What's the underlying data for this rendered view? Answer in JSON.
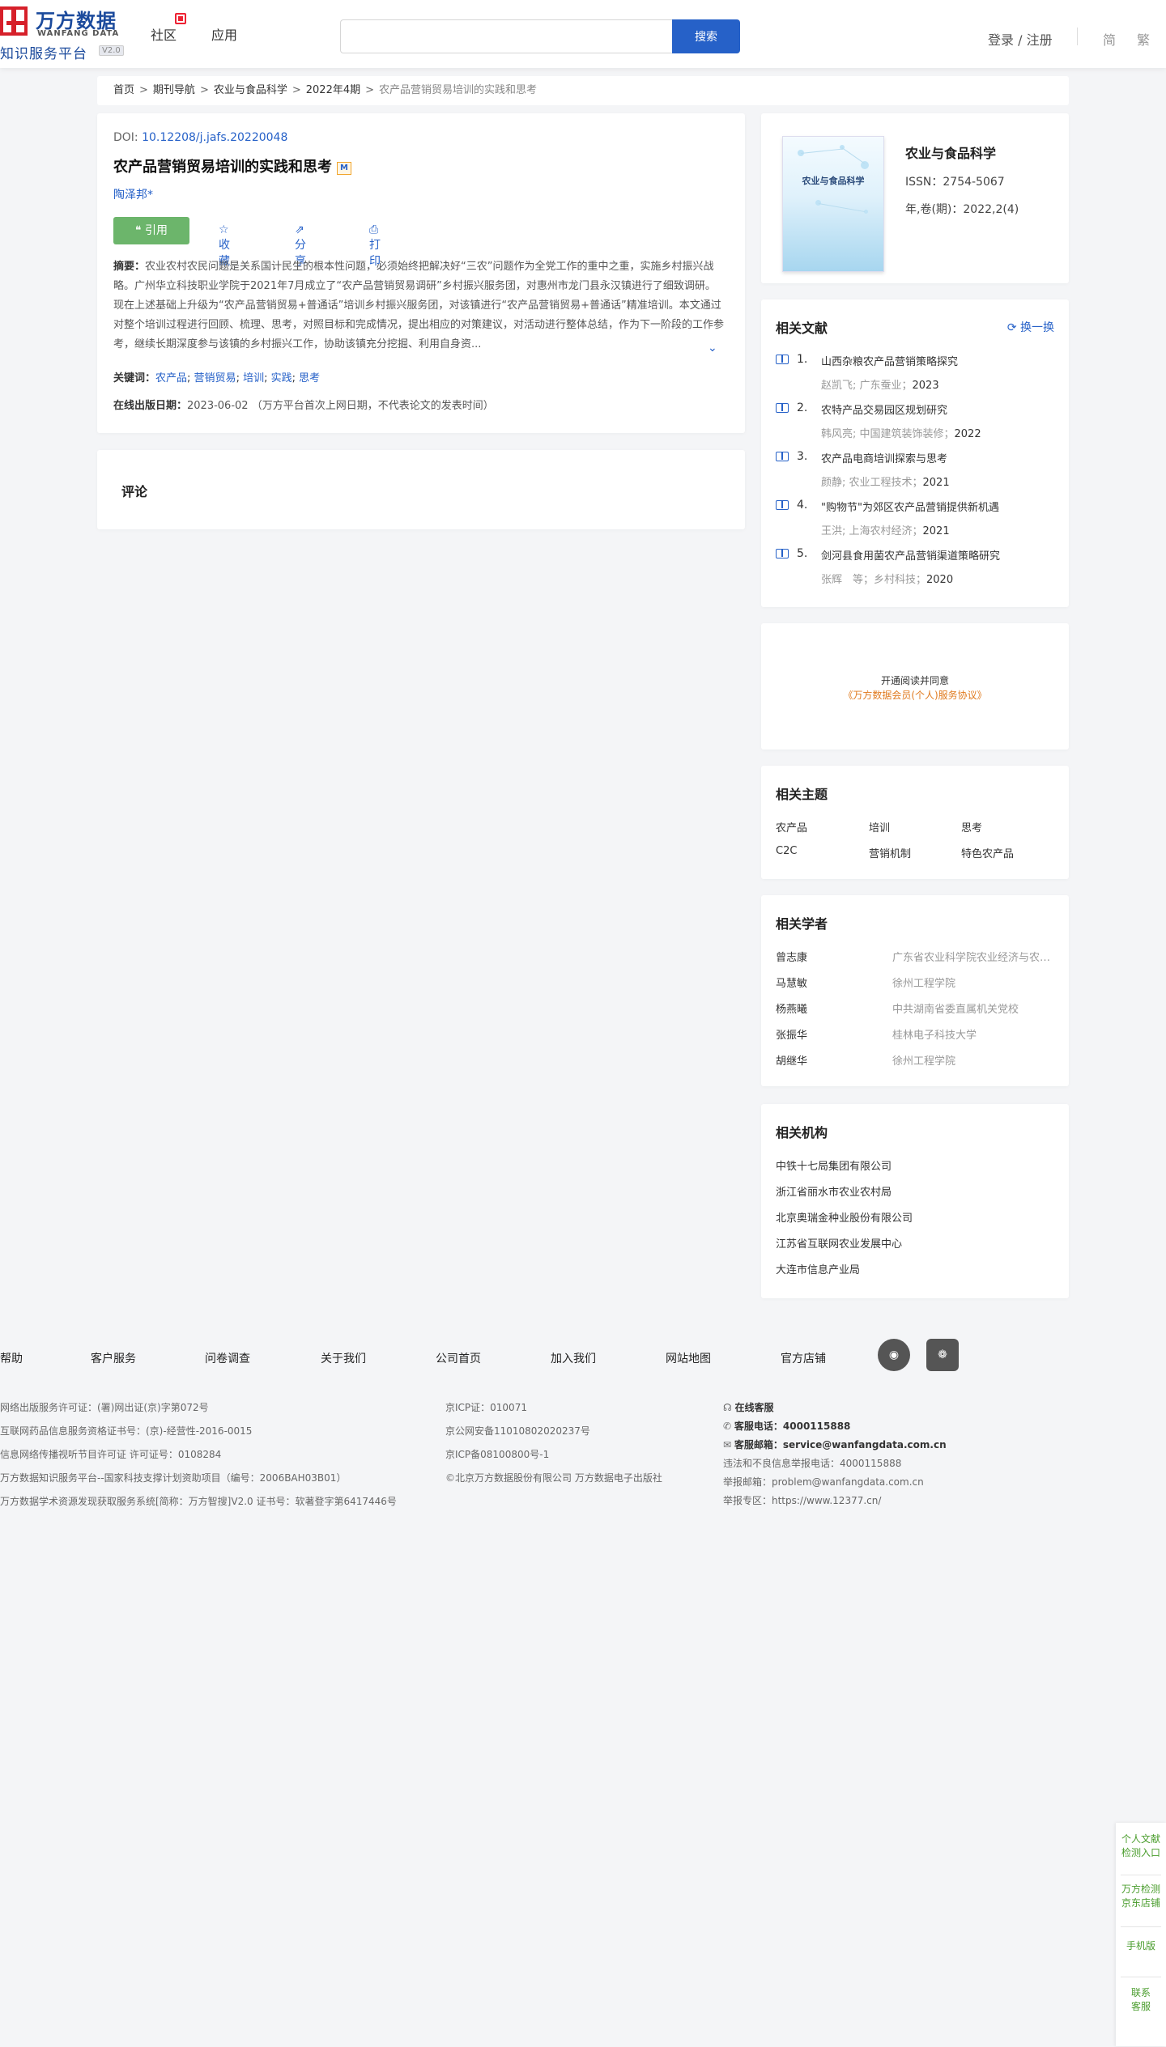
{
  "header": {
    "logo_cn": "万方数据",
    "logo_en": "WANFANG DATA",
    "logo_sub": "知识服务平台",
    "logo_version": "V2.0",
    "nav": [
      "社区",
      "应用"
    ],
    "search_placeholder": "",
    "search_button": "搜索",
    "login": "登录 / 注册",
    "lang_simplified": "简",
    "lang_traditional": "繁"
  },
  "breadcrumb": {
    "items": [
      "首页",
      "期刊导航",
      "农业与食品科学",
      "2022年4期"
    ],
    "current": "农产品营销贸易培训的实践和思考",
    "separator": ">"
  },
  "article": {
    "doi_label": "DOI:",
    "doi": "10.12208/j.jafs.20220048",
    "title": "农产品营销贸易培训的实践和思考",
    "m_badge": "M",
    "author": "陶泽邦*",
    "actions": {
      "cite": "引用",
      "favorite": "收藏",
      "share": "分享",
      "print": "打印"
    },
    "abstract_label": "摘要：",
    "abstract": "农业农村农民问题是关系国计民生的根本性问题，必须始终把解决好“三农”问题作为全党工作的重中之重，实施乡村振兴战略。广州华立科技职业学院于2021年7月成立了“农产品营销贸易调研”乡村振兴服务团，对惠州市龙门县永汉镇进行了细致调研。现在上述基础上升级为“农产品营销贸易+普通话”培训乡村振兴服务团，对该镇进行“农产品营销贸易+普通话”精准培训。本文通过对整个培训过程进行回顾、梳理、思考，对照目标和完成情况，提出相应的对策建议，对活动进行整体总结，作为下一阶段的工作参考，继续长期深度参与该镇的乡村振兴工作，协助该镇充分挖掘、利用自身资...",
    "keywords_label": "关键词：",
    "keywords": [
      "农产品",
      "营销贸易",
      "培训",
      "实践",
      "思考"
    ],
    "pubdate_label": "在线出版日期：",
    "pubdate": "2023-06-02",
    "pubdate_note": "（万方平台首次上网日期，不代表论文的发表时间）"
  },
  "comment": {
    "title": "评论"
  },
  "journal": {
    "cover_title": "农业与食品科学",
    "name": "农业与食品科学",
    "issn": "ISSN：2754-5067",
    "year_issue": "年,卷(期)：2022,2(4)"
  },
  "related_docs": {
    "title": "相关文献",
    "refresh": "换一换",
    "items": [
      {
        "num": "1.",
        "title": "山西杂粮农产品营销策略探究",
        "meta": "赵凯飞; 广东蚕业；",
        "year": "2023"
      },
      {
        "num": "2.",
        "title": "农特产品交易园区规划研究",
        "meta": "韩风亮; 中国建筑装饰装修；",
        "year": "2022"
      },
      {
        "num": "3.",
        "title": "农产品电商培训探索与思考",
        "meta": "颜静; 农业工程技术；",
        "year": "2021"
      },
      {
        "num": "4.",
        "title": "\"购物节\"为郊区农产品营销提供新机遇",
        "meta": "王洪; 上海农村经济；",
        "year": "2021"
      },
      {
        "num": "5.",
        "title": "剑河县食用菌农产品营销渠道策略研究",
        "meta": "张辉　等；乡村科技；",
        "year": "2020"
      }
    ]
  },
  "promo": {
    "line1": "开通阅读并同意",
    "line2": "《万方数据会员(个人)服务协议》"
  },
  "topics": {
    "title": "相关主题",
    "items": [
      "农产品",
      "培训",
      "思考",
      "C2C",
      "营销机制",
      "特色农产品"
    ]
  },
  "scholars": {
    "title": "相关学者",
    "items": [
      {
        "name": "曾志康",
        "org": "广东省农业科学院农业经济与农村发展研究所"
      },
      {
        "name": "马慧敏",
        "org": "徐州工程学院"
      },
      {
        "name": "杨燕曦",
        "org": "中共湖南省委直属机关党校"
      },
      {
        "name": "张振华",
        "org": "桂林电子科技大学"
      },
      {
        "name": "胡继华",
        "org": "徐州工程学院"
      }
    ]
  },
  "orgs": {
    "title": "相关机构",
    "items": [
      "中铁十七局集团有限公司",
      "浙江省丽水市农业农村局",
      "北京奥瑞金种业股份有限公司",
      "江苏省互联网农业发展中心",
      "大连市信息产业局"
    ]
  },
  "footer": {
    "links": [
      "帮助",
      "客户服务",
      "问卷调查",
      "关于我们",
      "公司首页",
      "加入我们",
      "网站地图",
      "官方店铺"
    ],
    "col1": [
      "网络出版服务许可证：(署)网出证(京)字第072号",
      "互联网药品信息服务资格证书号：(京)-经营性-2016-0015",
      "信息网络传播视听节目许可证 许可证号：0108284",
      "万方数据知识服务平台--国家科技支撑计划资助项目（编号：2006BAH03B01）",
      "万方数据学术资源发现获取服务系统[简称：万方智搜]V2.0 证书号：软著登字第6417446号"
    ],
    "col2": [
      "京ICP证：010071",
      "京公网安备11010802020237号",
      "京ICP备08100800号-1",
      "©北京万方数据股份有限公司 万方数据电子出版社"
    ],
    "online_service": "在线客服",
    "phone_label": "客服电话：",
    "phone": "4000115888",
    "email_label": "客服邮箱：",
    "email": "service@wanfangdata.com.cn",
    "report_phone": "违法和不良信息举报电话：4000115888",
    "report_email": "举报邮箱：problem@wanfangdata.com.cn",
    "report_zone": "举报专区：https://www.12377.cn/"
  },
  "float_bar": {
    "items": [
      "个人文献\n检测入口",
      "万方检测\n京东店铺",
      "手机版",
      "联系\n客服"
    ]
  }
}
